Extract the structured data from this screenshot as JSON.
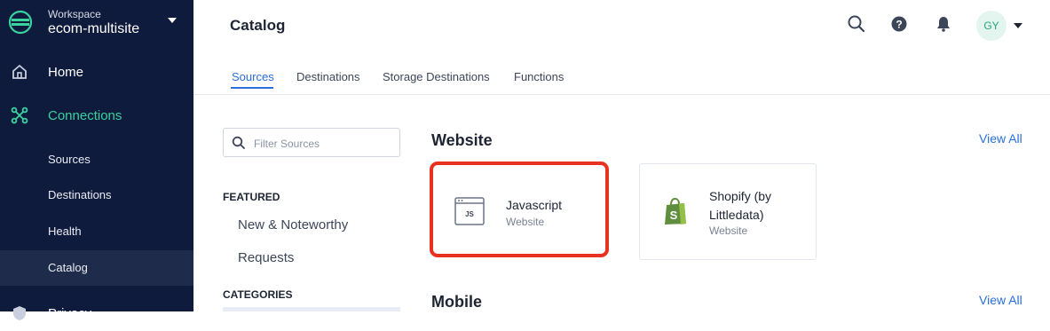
{
  "sidebar": {
    "workspace_label": "Workspace",
    "workspace_name": "ecom-multisite",
    "nav": {
      "home": "Home",
      "connections": "Connections"
    },
    "sub_items": [
      "Sources",
      "Destinations",
      "Health",
      "Catalog"
    ],
    "active_sub_item": "Catalog",
    "partial_item": "Privacy"
  },
  "header": {
    "title": "Catalog",
    "avatar_initials": "GY"
  },
  "tabs": [
    "Sources",
    "Destinations",
    "Storage Destinations",
    "Functions"
  ],
  "active_tab": "Sources",
  "filter": {
    "placeholder": "Filter Sources",
    "value": ""
  },
  "left_panel": {
    "featured_heading": "FEATURED",
    "featured_links": [
      "New & Noteworthy",
      "Requests"
    ],
    "categories_heading": "CATEGORIES"
  },
  "groups": [
    {
      "heading": "Website",
      "view_all": "View All",
      "cards": [
        {
          "title": "Javascript",
          "subtitle": "Website",
          "icon": "js-window-icon",
          "highlighted": true
        },
        {
          "title_lines": [
            "Shopify (by",
            "Littledata)"
          ],
          "subtitle": "Website",
          "icon": "shopify-bag-icon"
        }
      ]
    },
    {
      "heading": "Mobile",
      "view_all": "View All"
    }
  ],
  "colors": {
    "sidebar_bg": "#0f1b3d",
    "accent_green": "#3ad29f",
    "link_blue": "#2a6fdb",
    "highlight_red": "#e8321f"
  }
}
